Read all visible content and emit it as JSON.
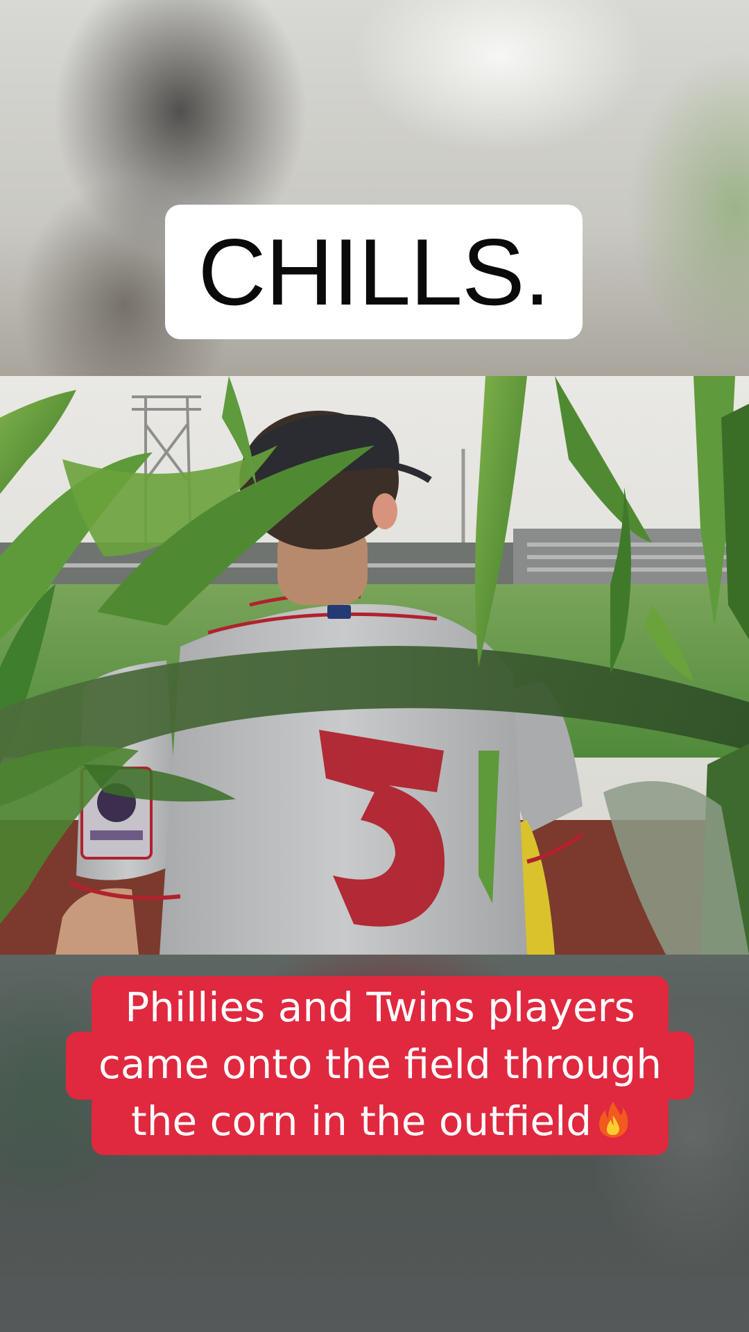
{
  "title_card": {
    "text": "CHILLS."
  },
  "caption": {
    "lines": [
      "Phillies and Twins players",
      "came onto the field through",
      "the corn in the outfield"
    ],
    "emoji": "fire-emoji"
  },
  "video": {
    "scene": "baseball-player-walking-through-corn",
    "jersey_number": "3"
  },
  "colors": {
    "caption_bg": "#e0283f",
    "title_bg": "#ffffff",
    "title_text": "#0a0a0a"
  }
}
